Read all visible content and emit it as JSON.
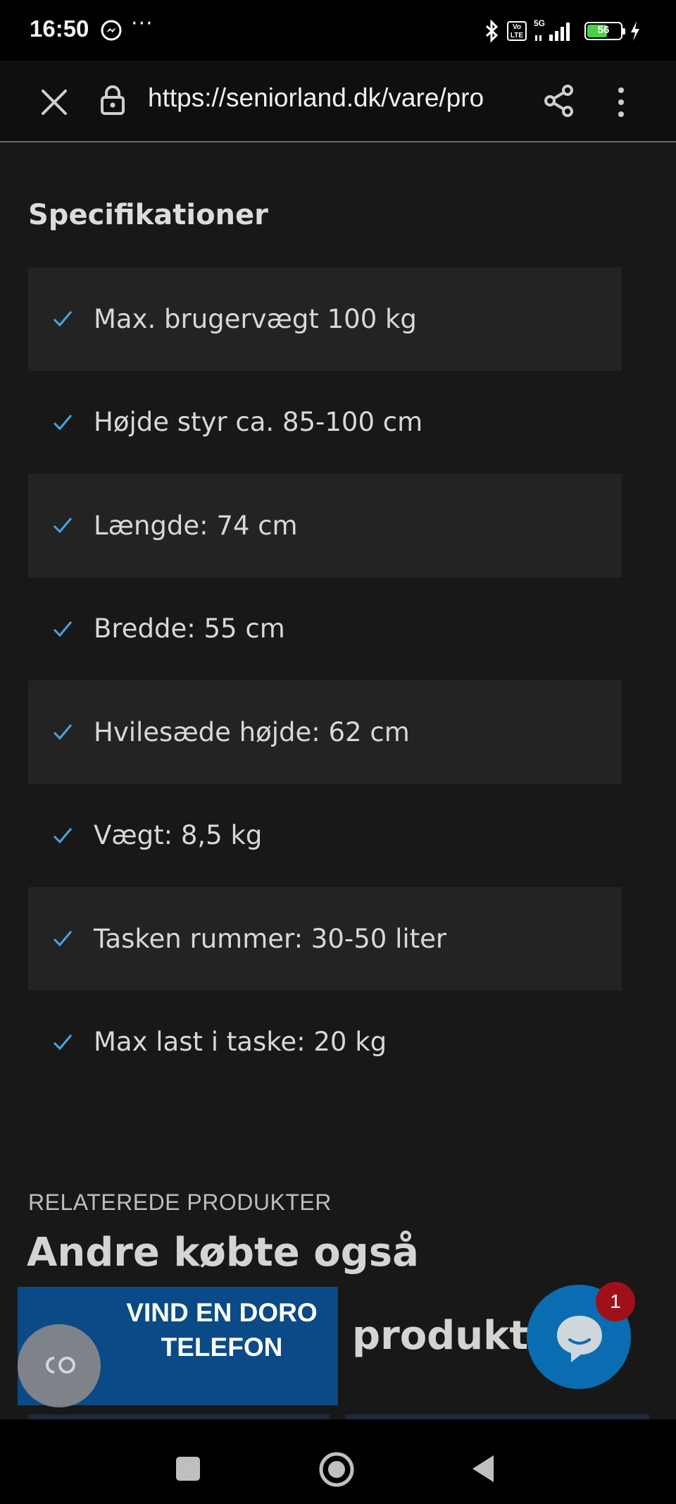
{
  "status_bar": {
    "time": "16:50",
    "more": "···",
    "volte": "Vo LTE",
    "network": "5G",
    "battery_level": "56",
    "icons": [
      "messenger-icon",
      "bluetooth-icon",
      "volte-icon",
      "signal-icon",
      "battery-icon",
      "charging-icon"
    ]
  },
  "browser": {
    "url": "https://seniorland.dk/vare/pro",
    "icons": [
      "close-icon",
      "lock-icon",
      "share-icon",
      "more-vert-icon"
    ]
  },
  "specs": {
    "title": "Specifikationer",
    "items": [
      "Max. brugervægt 100 kg",
      "Højde styr ca. 85-100 cm",
      "Længde: 74 cm",
      "Bredde: 55 cm",
      "Hvilesæde højde: 62 cm",
      "Vægt: 8,5 kg",
      "Tasken rummer: 30-50 liter",
      "Max last i taske: 20 kg"
    ]
  },
  "related": {
    "eyebrow": "RELATEREDE PRODUKTER",
    "title": "Andre købte også",
    "title_overflow": "produkt"
  },
  "promo": {
    "label": "VIND EN DORO TELEFON"
  },
  "chat": {
    "badge_count": "1"
  },
  "colors": {
    "background": "#181818",
    "accent_check": "#4aa3e0",
    "promo_blue": "#0a4a86",
    "chat_blue": "#0a6db1",
    "badge_red": "#a0101b"
  }
}
